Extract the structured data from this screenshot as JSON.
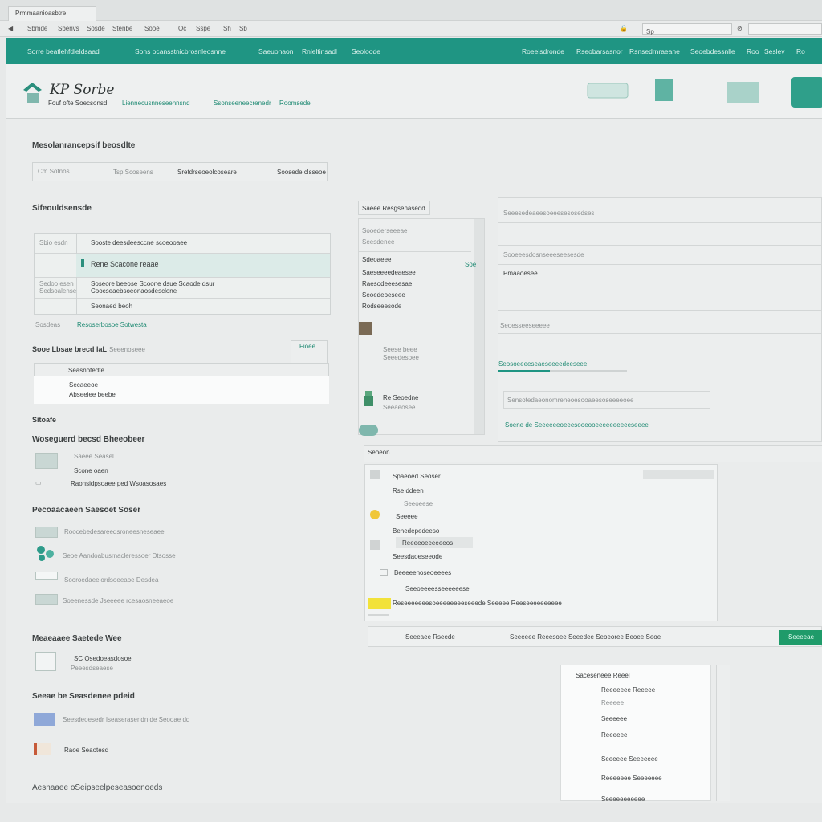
{
  "browser": {
    "tab_title": "Prmmaanioasbtre",
    "nav_items": [
      "Sbmde",
      "Sbenvs",
      "Sosde",
      "Stenbe",
      "Sooe",
      "Oc",
      "Sspe",
      "Sh",
      "Sb"
    ],
    "address_value": "Sp",
    "security_glyph": "⊘"
  },
  "site_nav": {
    "left_items": [
      "Sorre beatlehfdleldsaad",
      "Sons ocansstnicbrosnleosnne",
      "Saeuonaon",
      "Rnleltinsadl",
      "Seoloode"
    ],
    "right_items": [
      "Roeelsdronde",
      "Rseobarsasnor",
      "Rsnsedrnraeane",
      "Seoebdessnlle",
      "Roo",
      "Seslev",
      "Ro"
    ]
  },
  "header": {
    "logo_text": "KP Sorbe",
    "tagline": "Fouf ofte Soecsonsd",
    "links": [
      "Liennecusnneseennsnd",
      "Ssonseeneecrenedr",
      "Roomsede"
    ]
  },
  "left": {
    "section1_title": "Mesolanrancepsif beosdlte",
    "breadcrumb": [
      "Cm Sotnos",
      "Tsp Scoseens",
      "Sretdrseoeolcoseare",
      "Soosede clsseoe"
    ],
    "section2_title": "Sifeouldsensde",
    "table_rows": [
      {
        "label": "Sbio esdn",
        "text": "Sooste deesdeesccne scoeooaee"
      },
      {
        "label": "",
        "text": "Rene Scacone reaae"
      },
      {
        "label": "Sedoo esen Sedsoalense",
        "text": "Soseore beeose Scoone dsue Scaode dsur Coocseaebsoeonaosdesclone"
      },
      {
        "label": "",
        "text": "Seonaed beoh"
      }
    ],
    "row_footer": {
      "left": "Sosdeas",
      "right": "Resoserbosoe Sotwesta"
    },
    "sub_title": "Sooe Lbsae brecd laL",
    "sub_title_link": "Seeenoseee",
    "side_caption": "Fioee",
    "selected_head": "Seasnotedte",
    "selected_line1": "Secaeeoe",
    "selected_line2": "Abseeiee beebe",
    "section3_title": "Sitoafe",
    "section4_title": "Woseguerd becsd Bheeobeer",
    "list_a": [
      "Saeee Seasel",
      "Scone oaen",
      "Raonsidpsoaee ped Wsoasosaes"
    ],
    "section5_title": "Pecoaacaeen Saesoet Soser",
    "list_b": [
      "Roocebedesareedsroneesneseaee",
      "Seoe Aandoabusrnacleressoer Dtsosse",
      "Sooroedaeeiordsoeeaoe Desdea",
      "Soeenessde Jseeeee rcesaosneeaeoe"
    ],
    "section6_title": "Meaeaaee Saetede Wee",
    "list_c": [
      "SC Osedoeasdosoe",
      "Peeesdseaese"
    ],
    "section7_title": "Seeae be Seasdenee pdeid",
    "list_d": [
      "Seesdeoesedr Iseaserasendn de Seooae dq",
      "Raoe Seaotesd"
    ],
    "footer_title": "Aesnaaee oSeipseelpeseasoenoeds"
  },
  "middle": {
    "panel_title": "Saeee Resgsenasedd",
    "items": [
      "Sooederseeeae",
      "Seesdenee",
      "Sdeoaeee",
      "Saeseeeedeaesee",
      "Raesodeeesesae",
      "Seoedeoeseee",
      "Rodseeesode"
    ],
    "badge": "Soe",
    "caption_a": "Seese beee",
    "caption_b": "Seeedesoee",
    "caption_c": "Re Seoedne",
    "caption_d": "Seeaeosee"
  },
  "right": {
    "field1": "Seeesedeaeesoeeesesosedses",
    "field2": "Sooeeesdosnseeeseesesde",
    "field2_value": "Pmaaoesee",
    "field3": "Seoesseeseeeee",
    "field4": "Seosoeeeeseaeseeeedeeseee",
    "field5": "Sensotedaeonomreneoesooaeesoseeeeoee",
    "field6": "Soene de Seeeeeeoeeesooeooeeeeeeeeeeseeee",
    "progress_pct": 40
  },
  "dialog": {
    "title": "Seoeon",
    "rows": [
      "Spaeoed Seoser",
      "Rse ddeen",
      "Seeoeese",
      "Seeeee",
      "Benedepedeeso",
      "Reeeeoeeeeeeos",
      "Seesdaoeseeode",
      "Beeeeenoseoeeees",
      "Seeoeeeesseeeeeese",
      "Reseeeeeeesoeeeeeeeeseeede Seeeee Reeseeeeeeeeee"
    ],
    "footer_left": "Seeeaee Rseede",
    "footer_middle": "Seeeeee Reeesoee Seeedee Seoeoree Beoee Seoe",
    "footer_button": "Seeeeae"
  },
  "popup": {
    "title": "Saceseneee Reeel",
    "items": [
      "Reeeeeee Reeeee",
      "Reeeee",
      "Seeeeee",
      "Reeeeee",
      "Seeeeee Seeeeeee",
      "Reeeeeee Seeeeeee",
      "Seeeeeeeeeee"
    ]
  },
  "colors": {
    "accent": "#1f9583",
    "button": "#1f9b6a",
    "highlight": "#f2e23a"
  }
}
